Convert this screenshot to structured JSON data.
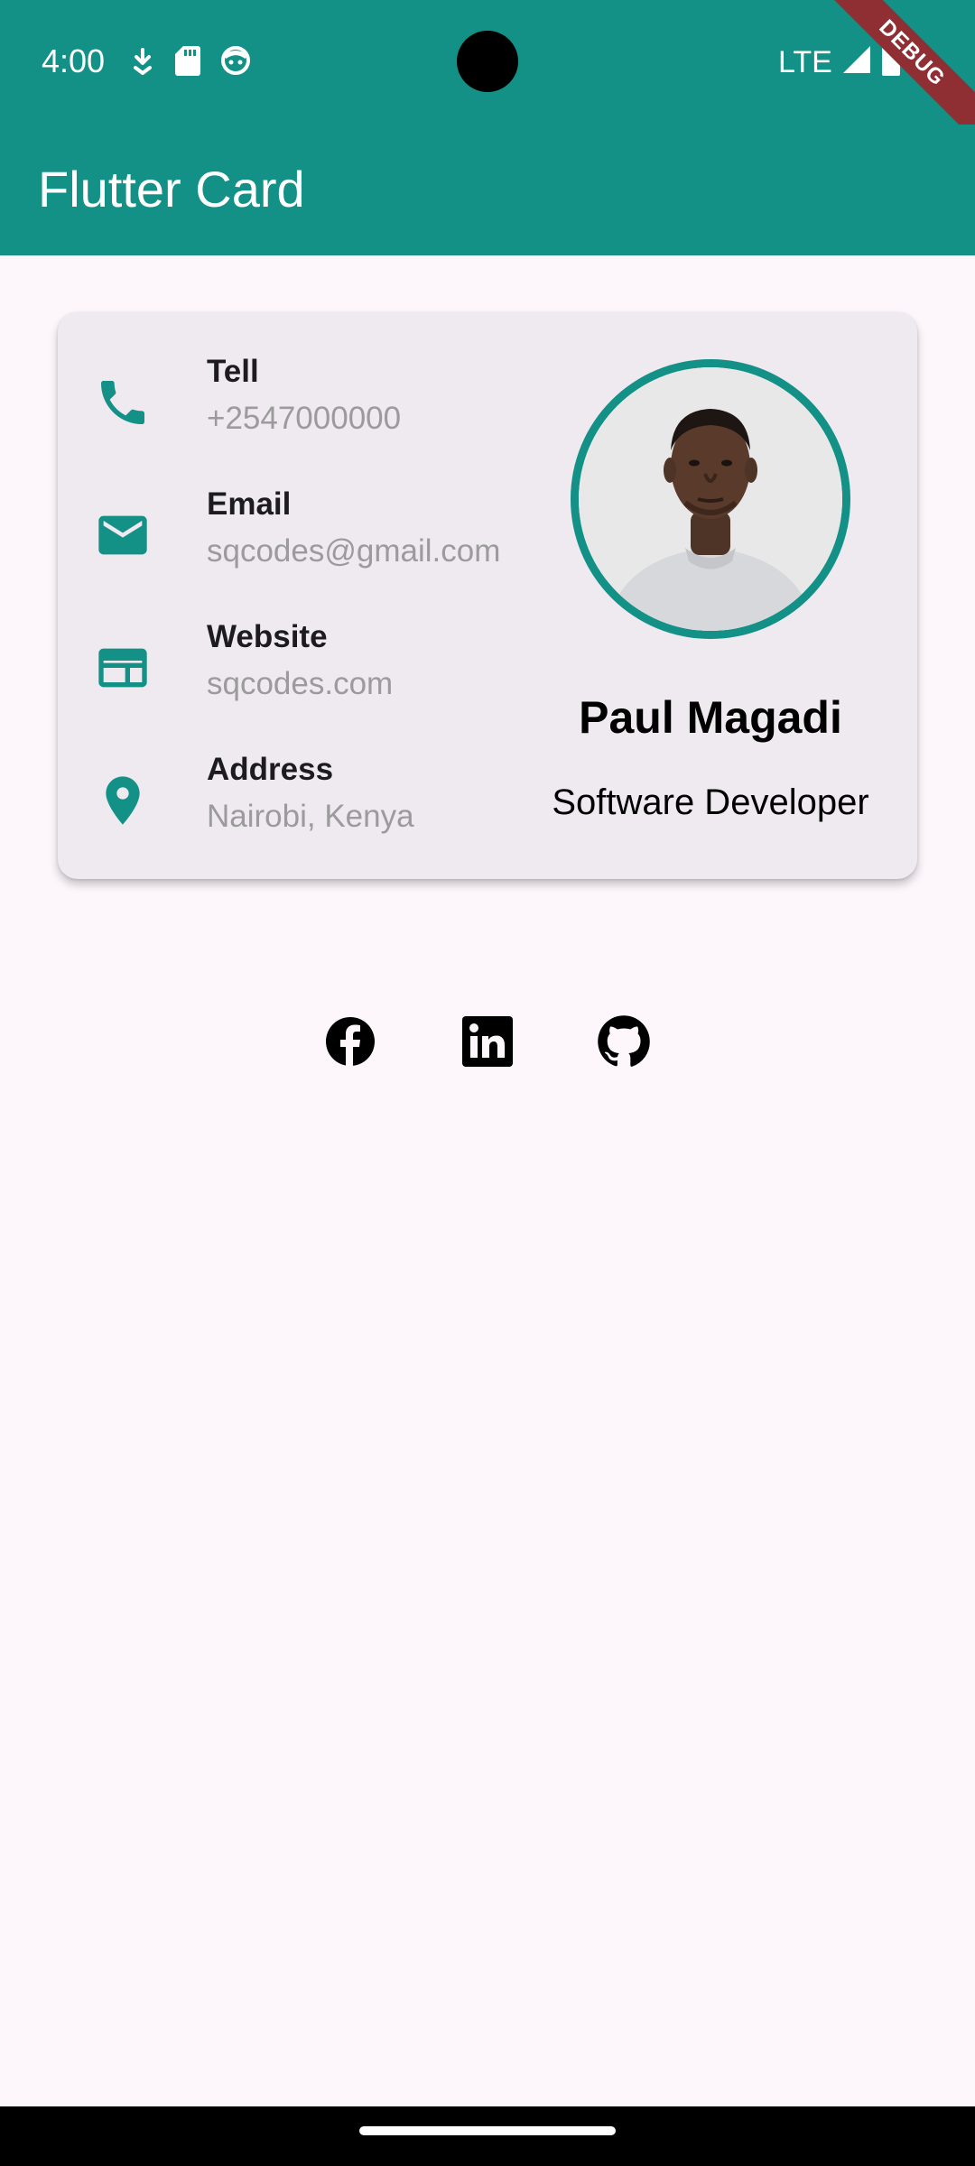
{
  "status_bar": {
    "time": "4:00",
    "network": "LTE",
    "debug_label": "DEBUG",
    "icons_left": [
      "download-icon",
      "sd-card-icon",
      "face-icon"
    ],
    "icons_right": [
      "signal-icon",
      "battery-icon"
    ]
  },
  "app_bar": {
    "title": "Flutter Card"
  },
  "contact": {
    "items": [
      {
        "icon": "phone-icon",
        "label": "Tell",
        "value": "+2547000000"
      },
      {
        "icon": "email-icon",
        "label": "Email",
        "value": "sqcodes@gmail.com"
      },
      {
        "icon": "website-icon",
        "label": "Website",
        "value": "sqcodes.com"
      },
      {
        "icon": "location-icon",
        "label": "Address",
        "value": "Nairobi, Kenya"
      }
    ]
  },
  "profile": {
    "name": "Paul Magadi",
    "role": "Software Developer"
  },
  "social": {
    "links": [
      {
        "icon": "facebook-icon",
        "label": "Facebook"
      },
      {
        "icon": "linkedin-icon",
        "label": "LinkedIn"
      },
      {
        "icon": "github-icon",
        "label": "GitHub"
      }
    ]
  },
  "colors": {
    "primary": "#139187",
    "card_background": "#efe9f0",
    "page_background": "#fdf7fb",
    "secondary_text": "#9b9b9b",
    "debug_banner": "#8f2f33"
  }
}
